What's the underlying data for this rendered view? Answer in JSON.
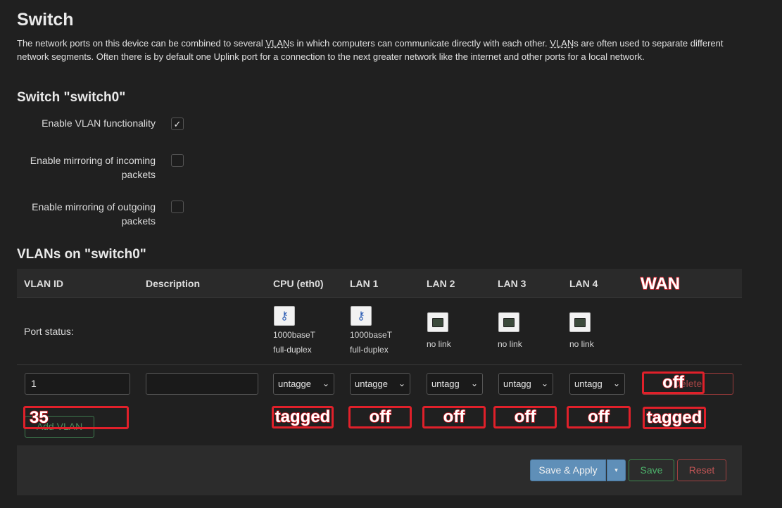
{
  "page": {
    "title": "Switch",
    "description_parts": [
      "The network ports on this device can be combined to several ",
      "VLAN",
      "s in which computers can communicate directly with each other. ",
      "VLAN",
      "s are often used to separate different network segments. Often there is by default one Uplink port for a connection to the next greater network like the internet and other ports for a local network."
    ]
  },
  "switch": {
    "heading": "Switch \"switch0\"",
    "options": [
      {
        "label_line1": "Enable VLAN functionality",
        "label_line2": "",
        "checked": true,
        "check_glyph": "✓"
      },
      {
        "label_line1": "Enable mirroring of incoming",
        "label_line2": "packets",
        "checked": false,
        "check_glyph": ""
      },
      {
        "label_line1": "Enable mirroring of outgoing",
        "label_line2": "packets",
        "checked": false,
        "check_glyph": ""
      }
    ]
  },
  "vlans": {
    "heading": "VLANs on \"switch0\"",
    "headers": [
      "VLAN ID",
      "Description",
      "CPU (eth0)",
      "LAN 1",
      "LAN 2",
      "LAN 3",
      "LAN 4"
    ],
    "port_status_label": "Port status:",
    "ports": [
      {
        "icon": "ethernet-connected-icon",
        "line1": "1000baseT",
        "line2": "full-duplex"
      },
      {
        "icon": "ethernet-connected-icon",
        "line1": "1000baseT",
        "line2": "full-duplex"
      },
      {
        "icon": "ethernet-port-icon",
        "line1": "no link",
        "line2": ""
      },
      {
        "icon": "ethernet-port-icon",
        "line1": "no link",
        "line2": ""
      },
      {
        "icon": "ethernet-port-icon",
        "line1": "no link",
        "line2": ""
      }
    ],
    "row": {
      "vlan_id": "1",
      "description": "",
      "selects": [
        "untagge",
        "untagge",
        "untagg",
        "untagg",
        "untagg"
      ],
      "delete_label": "Delete"
    },
    "add_label": "Add VLAN",
    "chevron": "⌄"
  },
  "footer": {
    "save_apply": "Save & Apply",
    "caret": "▾",
    "save": "Save",
    "reset": "Reset"
  },
  "annotations": {
    "wan_header": "WAN",
    "row1_wan": "off",
    "row2_vlan_id": "35",
    "row2_cpu": "tagged",
    "row2_lan1": "off",
    "row2_lan2": "off",
    "row2_lan3": "off",
    "row2_lan4": "off",
    "row2_wan": "tagged",
    "color": "#e0202a"
  },
  "colors": {
    "background": "#202020",
    "apply_blue": "#5f8fb8",
    "save_green": "#4caf6a",
    "reset_red": "#c05555"
  }
}
